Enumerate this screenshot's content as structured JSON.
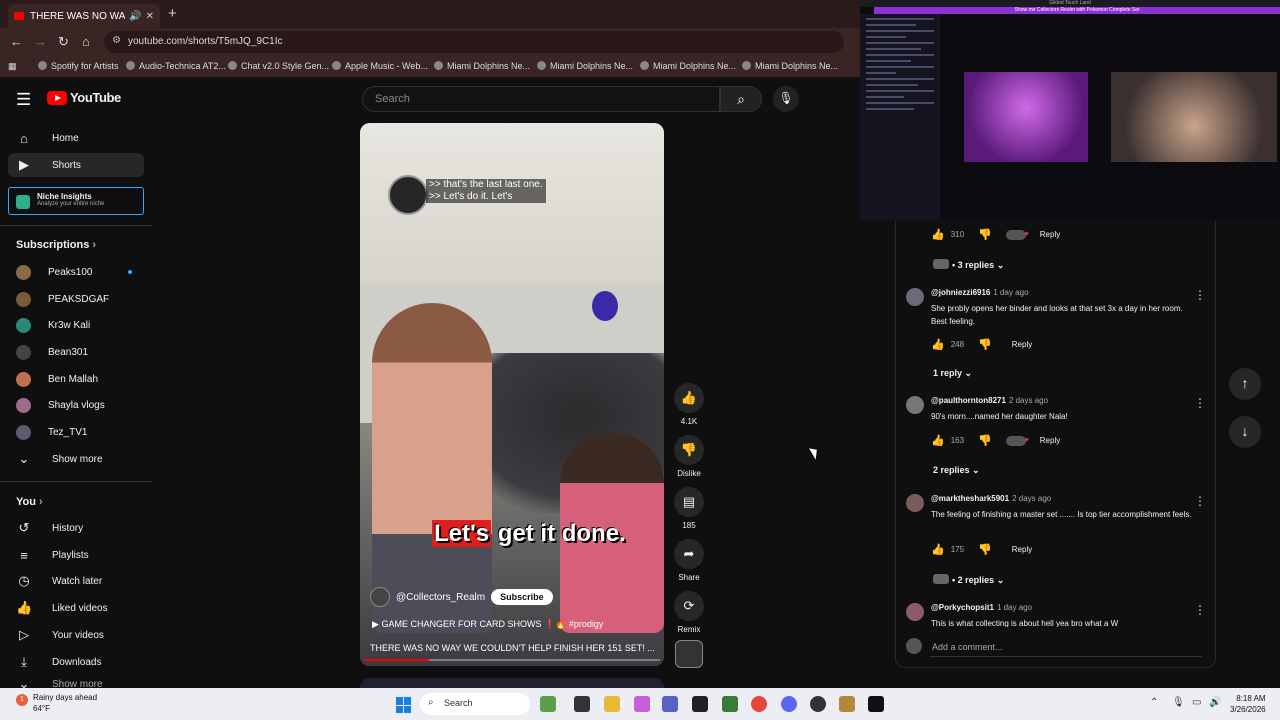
{
  "browser": {
    "tab_title": "THERE WAS NO WAY WE COULDN'T",
    "url": "youtube.com/shorts/T5mJQ_9C1Ic",
    "bookmarks": [
      {
        "label": "Spotify for Artists"
      },
      {
        "label": "Audio-Technica AT2..."
      },
      {
        "label": "Chat v2.0 Style Gen..."
      },
      {
        "label": "Apple Music - Web..."
      },
      {
        "label": "Miami Dolphins Ne..."
      },
      {
        "label": "Miami Dolphins Ne..."
      },
      {
        "label": "Miami Dolphins Ne..."
      },
      {
        "label": "Miami Dolphins Ne..."
      }
    ]
  },
  "header": {
    "logo_text": "YouTube",
    "search_placeholder": "Search"
  },
  "sidebar": {
    "home": "Home",
    "shorts": "Shorts",
    "niche_title": "Niche Insights",
    "niche_subtitle": "Analyze your entire niche",
    "subscriptions_title": "Subscriptions",
    "subscriptions": [
      {
        "name": "Peaks100",
        "color": "#8a6a4a"
      },
      {
        "name": "PEAKSDGAF",
        "color": "#7a5a3a"
      },
      {
        "name": "Kr3w Kali",
        "color": "#2a8a7a"
      },
      {
        "name": "Bean301",
        "color": "#444444"
      },
      {
        "name": "Ben Mallah",
        "color": "#c07050"
      },
      {
        "name": "Shayla vlogs",
        "color": "#a06a8a"
      },
      {
        "name": "Tez_TV1",
        "color": "#5a5a70"
      }
    ],
    "show_more": "Show more",
    "you_title": "You",
    "you_items": [
      "History",
      "Playlists",
      "Watch later",
      "Liked videos",
      "Your videos",
      "Downloads"
    ],
    "cut_off_item": "Show more"
  },
  "video": {
    "caption_line1": ">> that's the last last one.",
    "caption_line2": ">> Let's do it. Let's",
    "big_caption_word1": "Let's",
    "big_caption_rest": "get it done.",
    "channel": "@Collectors_Realm",
    "subscribe": "Subscribe",
    "description": "GAME CHANGER FOR CARD SHOWS",
    "description_tag": "#prodigy",
    "title": "THERE WAS NO WAY WE COULDN'T HELP FINISH HER 151 SET! ...",
    "progress": 0.22
  },
  "actions": {
    "likes": "4.1K",
    "dislike": "Dislike",
    "comments": "185",
    "share": "Share",
    "remix": "Remix"
  },
  "stream": {
    "title_bar": "Gilded Touch Land",
    "banner": "Show me Collectors Realm with Pokemon Complete Set"
  },
  "comments": {
    "top_partial": {
      "likes": "310",
      "reply": "Reply"
    },
    "top_partial_replies": "3 replies",
    "list": [
      {
        "handle": "@johniezzi6916",
        "time": "1 day ago",
        "text": "She probly opens her binder and looks at that set 3x a day in her room. Best feeling.",
        "likes": "248",
        "reply": "Reply",
        "replies": "1 reply"
      },
      {
        "handle": "@paulthornton8271",
        "time": "2 days ago",
        "text": "90's morn....named her daughter Nala!",
        "likes": "163",
        "reply": "Reply",
        "replies": "2 replies"
      },
      {
        "handle": "@marktheshark5901",
        "time": "2 days ago",
        "text": "The feeling of finishing a master set ....... Is top tier accomplishment feels.",
        "likes": "175",
        "reply": "Reply",
        "replies": "2 replies"
      },
      {
        "handle": "@Porkychopsit1",
        "time": "1 day ago",
        "text": "This is what collecting is about hell yea bro what a W"
      }
    ],
    "add_comment": "Add a comment..."
  },
  "taskbar": {
    "weather_line1": "Rainy days ahead",
    "weather_line2": "64°F",
    "search": "Search",
    "time": "8:18 AM",
    "date": "3/26/2026"
  },
  "colors": {
    "accent_red": "#ff0000",
    "link_blue": "#3ea6ff",
    "stream_purple": "#8e30d6"
  }
}
